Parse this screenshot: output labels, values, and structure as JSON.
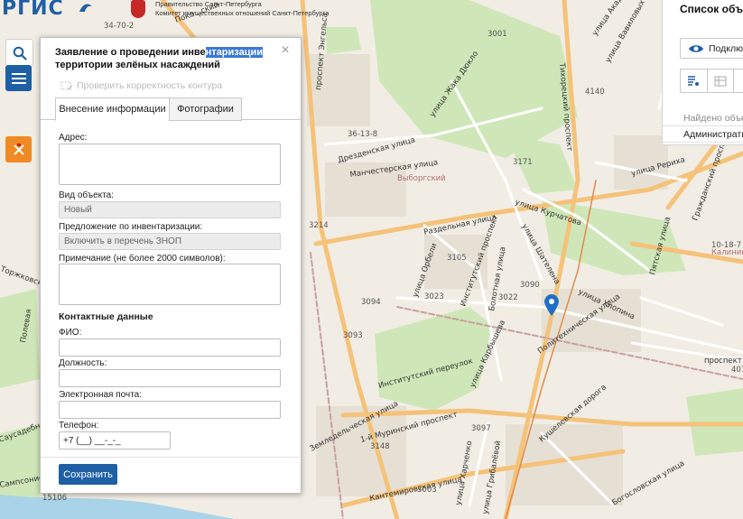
{
  "header": {
    "logo_text": "РГИС",
    "gov_lines": [
      "Правительство Санкт-Петербурга",
      "Комитет имущественных отношений Санкт-Петербурга"
    ]
  },
  "map": {
    "street_labels": [
      "проспект Энгельса",
      "Лесной проспект",
      "Тихорецкий проспект",
      "улица Жака Дюкло",
      "Дрезденская улица",
      "Манчестерская улица",
      "Выборгский",
      "улица Курчатова",
      "улица Шателена",
      "Раздельная улица",
      "улица Орбели",
      "Институтский проспект",
      "Болотная улица",
      "улица Хлопина",
      "Политехническая улица",
      "улица Карбышева",
      "Институтский переулок",
      "Земледельческая улица",
      "1-й Муринский проспект",
      "Кушелевская дорога",
      "улица Гжатская",
      "улица Рериха",
      "Гражданский проспект",
      "Пятская улица",
      "улица Харченко",
      "улица Грибалёвой",
      "Кантемировская улица",
      "Богословская улица",
      "проспект Непокорённых",
      "улица Академика Павлова",
      "улица Вавиловых",
      "Полевая",
      "Торжковская",
      "Калинина",
      "Саусадебная улица",
      "Сампсониевский",
      "Покл...ский"
    ],
    "numbers": [
      "3001",
      "34-70-2",
      "4140",
      "36-13-8",
      "3171",
      "3214",
      "3105",
      "3090",
      "3094",
      "3023",
      "3022",
      "3093",
      "3097",
      "3148",
      "3003",
      "15106",
      "10-18-7",
      "407"
    ]
  },
  "toolbar": {
    "search_icon": "search-icon",
    "menu_icon": "hamburger-icon",
    "spb_icon": "spb-emblem-icon"
  },
  "dialog": {
    "title_before": "Заявление о проведении инве",
    "title_selected": "нтаризации",
    "title_after": "территории зелёных насаждений",
    "close_label": "×",
    "check_contour_label": "Проверить корректность контура",
    "tabs": [
      {
        "label": "Внесение информации",
        "active": true
      },
      {
        "label": "Фотографии",
        "active": false
      }
    ],
    "address_label": "Адрес:",
    "object_type_label": "Вид объекта:",
    "object_type_value": "Новый",
    "proposal_label": "Предложение по инвентаризации:",
    "proposal_value": "Включить в перечень ЗНОП",
    "note_label": "Примечание (не более 2000 символов):",
    "contacts_title": "Контактные данные",
    "fio_label": "ФИО:",
    "position_label": "Должность:",
    "email_label": "Электронная почта:",
    "phone_label": "Телефон:",
    "phone_value": "+7 (__) __-_-_",
    "save_label": "Сохранить"
  },
  "right_panel": {
    "title": "Список объек",
    "connect_label": "Подклю",
    "found_label": "Найдено объе",
    "admin_label": "Администрати"
  }
}
